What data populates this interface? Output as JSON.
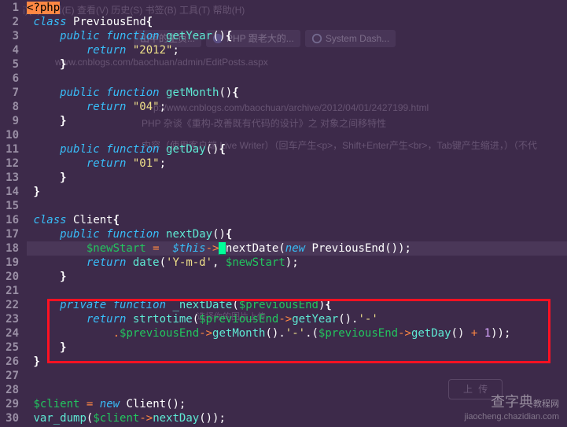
{
  "ghost": {
    "menu": "文(档)(F)  编辑(E)  查看(V)  历史(S)  书签(B)  工具(T)  帮助(H)",
    "url": "www.cnblogs.com/baochuan/admin/EditPosts.aspx",
    "tabs": [
      "山甲的主页...",
      "PHP 跟老大的...",
      "System Dash..."
    ],
    "archive_url": "p://www.cnblogs.com/baochuan/archive/2012/04/01/2427199.html",
    "title_cn": "PHP 杂谈《重构-改善既有代码的设计》之 对象之间移特性",
    "content_hint": "内容（使用客户端 Live Writer）（回车产生<p>，Shift+Enter产生<br>，Tab键产生缩进，）（不代",
    "upload_label": "上 传",
    "modal_title": "选择你的图片上传"
  },
  "watermark": {
    "main": "查字典",
    "sub": "教程网",
    "domain": "jiaocheng.chazidian.com"
  },
  "code": {
    "l1": {
      "open": "<?php"
    },
    "l2": {
      "kw": "class",
      "name": "PreviousEnd",
      "br": "{"
    },
    "l3": {
      "vis": "public",
      "kw": "function",
      "name": "getYear",
      "par": "()",
      "br": "{"
    },
    "l4": {
      "ret": "return",
      "val": "\"2012\"",
      "semi": ";"
    },
    "l5": {
      "br": "}"
    },
    "l7": {
      "vis": "public",
      "kw": "function",
      "name": "getMonth",
      "par": "()",
      "br": "{"
    },
    "l8": {
      "ret": "return",
      "val": "\"04\"",
      "semi": ";"
    },
    "l9": {
      "br": "}"
    },
    "l11": {
      "vis": "public",
      "kw": "function",
      "name": "getDay",
      "par": "()",
      "br": "{"
    },
    "l12": {
      "ret": "return",
      "val": "\"01\"",
      "semi": ";"
    },
    "l13": {
      "br": "}"
    },
    "l14": {
      "br": "}"
    },
    "l16": {
      "kw": "class",
      "name": "Client",
      "br": "{"
    },
    "l17": {
      "vis": "public",
      "kw": "function",
      "name": "nextDay",
      "par": "()",
      "br": "{"
    },
    "l18": {
      "var": "$newStart",
      "eq": "=",
      "this": "$this",
      "arrow": "->",
      "cursor": "_",
      "call": "nextDate",
      "p1": "(",
      "new": "new",
      "cls": "PreviousEnd",
      "p2": "());"
    },
    "l19": {
      "ret": "return",
      "fn": "date",
      "p1": "(",
      "s1": "'Y-m-d'",
      "c": ",",
      "var": "$newStart",
      "p2": ");"
    },
    "l20": {
      "br": "}"
    },
    "l22": {
      "vis": "private",
      "kw": "function",
      "name": "_nextDate",
      "p1": "(",
      "arg": "$previousEnd",
      "p2": ")",
      "br": "{"
    },
    "l23": {
      "ret": "return",
      "fn": "strtotime",
      "p1": "(",
      "var": "$previousEnd",
      "arrow": "->",
      "m": "getYear",
      "p2": "().",
      "s": "'-'"
    },
    "l24": {
      "dot": ".",
      "var1": "$previousEnd",
      "a1": "->",
      "m1": "getMonth",
      "p1": "().",
      "s1": "'-'",
      "d2": ".(",
      "var2": "$previousEnd",
      "a2": "->",
      "m2": "getDay",
      "p2": "()",
      "plus": "+",
      "one": "1",
      "end": "));"
    },
    "l25": {
      "br": "}"
    },
    "l26": {
      "br": "}"
    },
    "l29": {
      "var": "$client",
      "eq": "=",
      "new": "new",
      "cls": "Client",
      "end": "();"
    },
    "l30": {
      "fn": "var_dump",
      "p1": "(",
      "var": "$client",
      "arrow": "->",
      "m": "nextDay",
      "end": "());"
    }
  }
}
